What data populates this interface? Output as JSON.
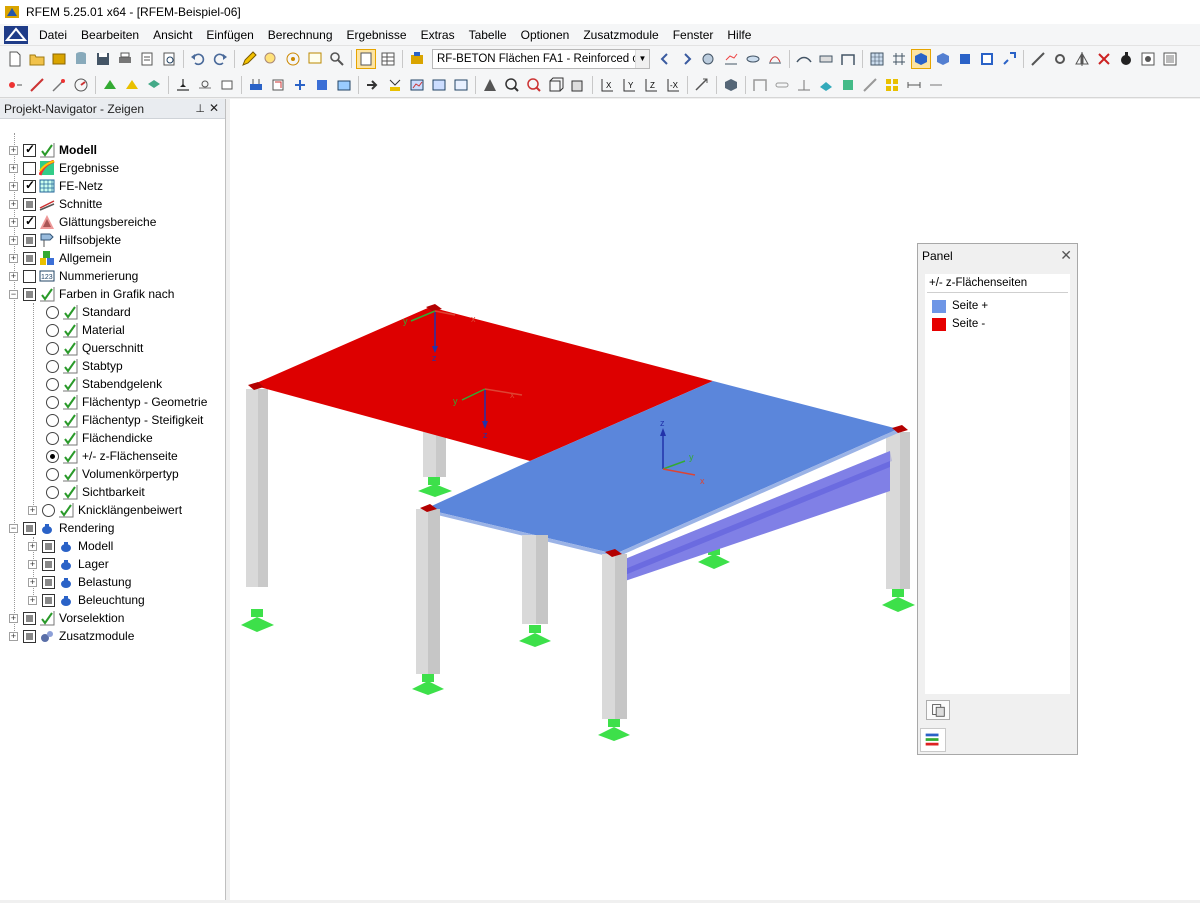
{
  "window": {
    "title": "RFEM 5.25.01 x64 - [RFEM-Beispiel-06]"
  },
  "menu": [
    "Datei",
    "Bearbeiten",
    "Ansicht",
    "Einfügen",
    "Berechnung",
    "Ergebnisse",
    "Extras",
    "Tabelle",
    "Optionen",
    "Zusatzmodule",
    "Fenster",
    "Hilfe"
  ],
  "toolbar": {
    "combo_value": "RF-BETON Flächen FA1 - Reinforced co"
  },
  "navigator": {
    "title": "Projekt-Navigator - Zeigen",
    "items": [
      "Modell",
      "Ergebnisse",
      "FE-Netz",
      "Schnitte",
      "Glättungsbereiche",
      "Hilfsobjekte",
      "Allgemein",
      "Nummerierung",
      "Farben in Grafik nach",
      "Standard",
      "Material",
      "Querschnitt",
      "Stabtyp",
      "Stabendgelenk",
      "Flächentyp - Geometrie",
      "Flächentyp - Steifigkeit",
      "Flächendicke",
      "+/- z-Flächenseite",
      "Volumenkörpertyp",
      "Sichtbarkeit",
      "Knicklängenbeiwert",
      "Rendering",
      "Modell",
      "Lager",
      "Belastung",
      "Beleuchtung",
      "Vorselektion",
      "Zusatzmodule"
    ]
  },
  "panel": {
    "title": "Panel",
    "subtitle": "+/- z-Flächenseiten",
    "legend": [
      {
        "label": "Seite +",
        "color": "#6e96e6"
      },
      {
        "label": "Seite -",
        "color": "#e60000"
      }
    ]
  },
  "viewport": {
    "axes": {
      "x": "x",
      "y": "y",
      "z": "z"
    },
    "colors": {
      "side_plus": "#5b86db",
      "side_minus": "#dd0000",
      "column": "#d4d4d4",
      "support": "#3de04a"
    }
  }
}
